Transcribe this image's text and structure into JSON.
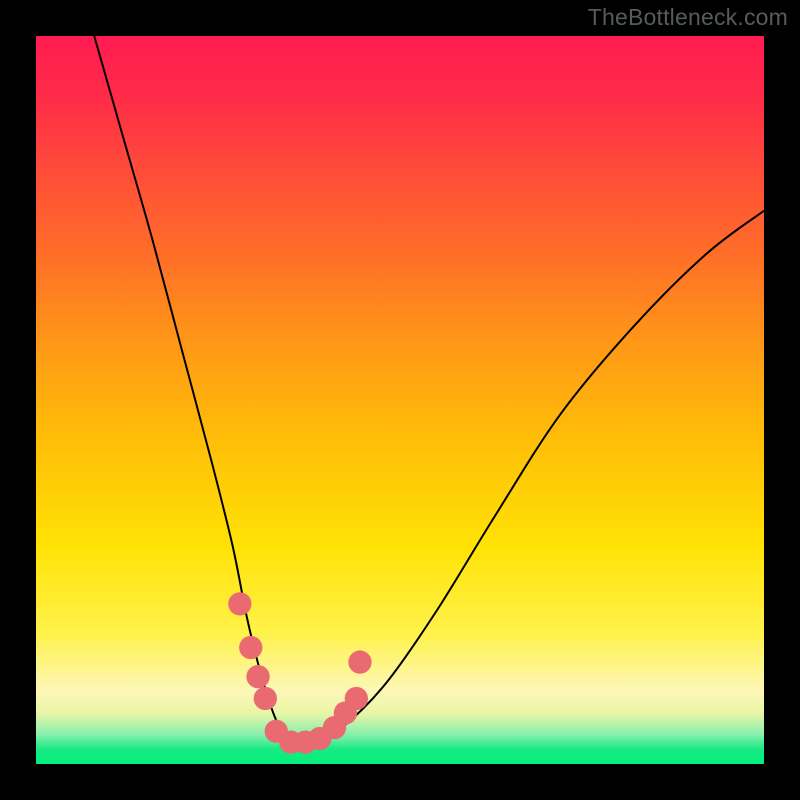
{
  "watermark": "TheBottleneck.com",
  "chart_data": {
    "type": "line",
    "title": "",
    "xlabel": "",
    "ylabel": "",
    "xlim": [
      0,
      100
    ],
    "ylim": [
      0,
      100
    ],
    "series": [
      {
        "name": "bottleneck-curve",
        "x": [
          8,
          12,
          16,
          20,
          24,
          27,
          29,
          31,
          33,
          35,
          38,
          42,
          48,
          55,
          63,
          72,
          82,
          92,
          100
        ],
        "values": [
          100,
          86,
          72,
          57,
          42,
          30,
          20,
          12,
          6,
          3,
          3,
          5,
          11,
          21,
          34,
          48,
          60,
          70,
          76
        ]
      }
    ],
    "markers": [
      {
        "name": "marker-left-1",
        "x": 28.0,
        "y": 22.0
      },
      {
        "name": "marker-left-2",
        "x": 29.5,
        "y": 16.0
      },
      {
        "name": "marker-left-3",
        "x": 30.5,
        "y": 12.0
      },
      {
        "name": "marker-left-4",
        "x": 31.5,
        "y": 9.0
      },
      {
        "name": "marker-floor-1",
        "x": 33.0,
        "y": 4.5
      },
      {
        "name": "marker-floor-2",
        "x": 35.0,
        "y": 3.0
      },
      {
        "name": "marker-floor-3",
        "x": 37.0,
        "y": 3.0
      },
      {
        "name": "marker-floor-4",
        "x": 39.0,
        "y": 3.5
      },
      {
        "name": "marker-right-1",
        "x": 41.0,
        "y": 5.0
      },
      {
        "name": "marker-right-2",
        "x": 42.5,
        "y": 7.0
      },
      {
        "name": "marker-right-3",
        "x": 44.0,
        "y": 9.0
      },
      {
        "name": "marker-detach",
        "x": 44.5,
        "y": 14.0
      }
    ],
    "gradient_stops": [
      {
        "pos": 0,
        "color": "#ff1c52"
      },
      {
        "pos": 18,
        "color": "#ff4a3a"
      },
      {
        "pos": 42,
        "color": "#ff9717"
      },
      {
        "pos": 70,
        "color": "#ffe205"
      },
      {
        "pos": 90,
        "color": "#fdf7b8"
      },
      {
        "pos": 100,
        "color": "#03f07d"
      }
    ]
  }
}
